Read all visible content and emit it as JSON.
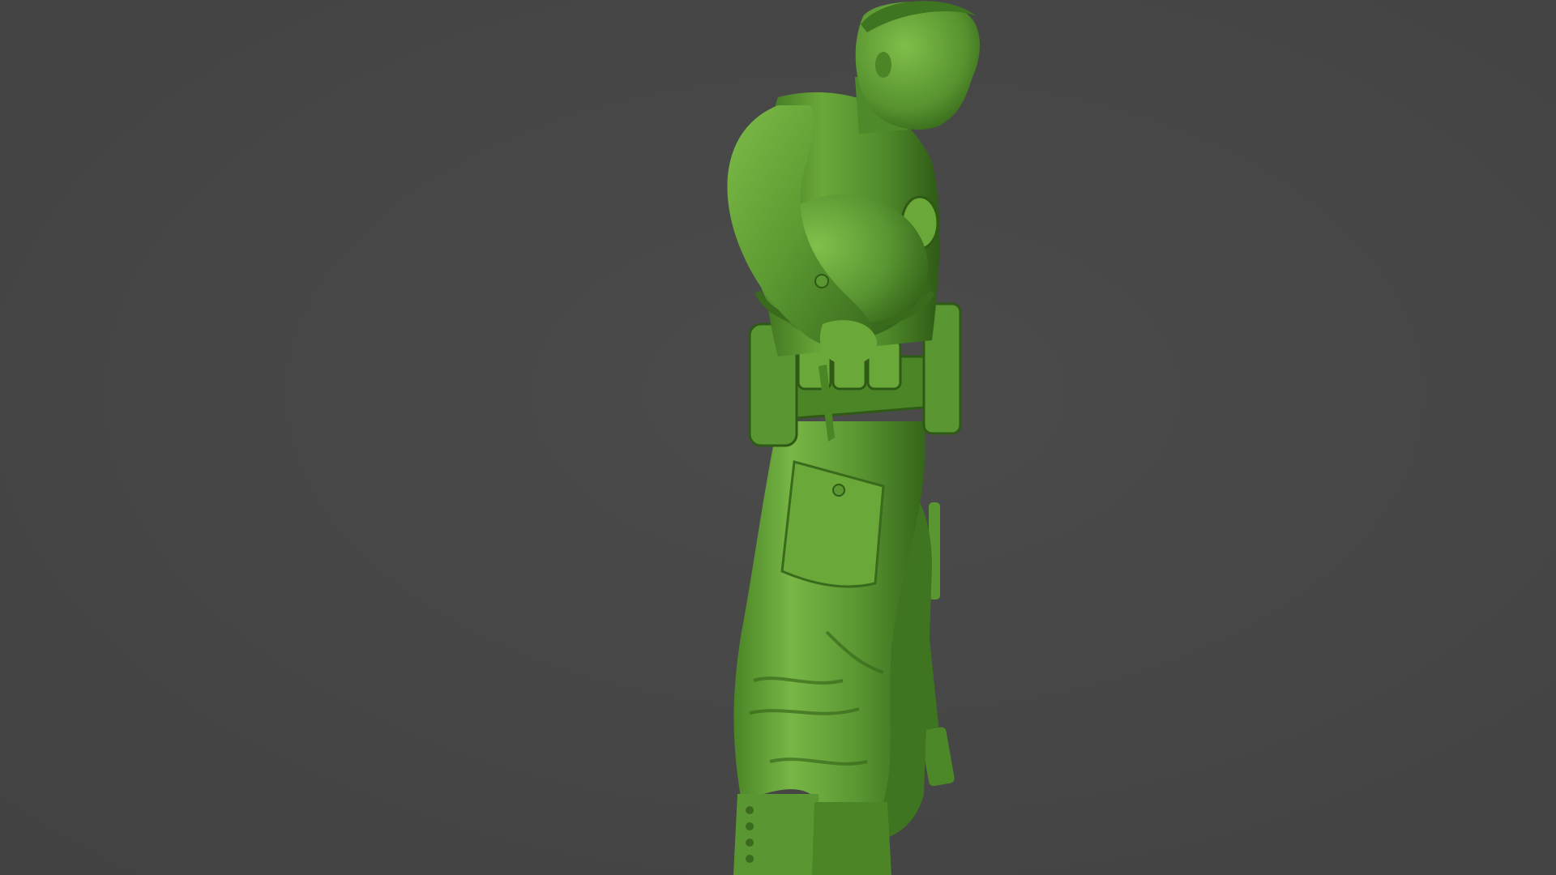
{
  "scene": {
    "background_color": "#464646",
    "model_color": "#4f8a2a",
    "model_highlight": "#7fbf4a",
    "model_shadow": "#2f5a16",
    "subject": "green-army-soldier-figure"
  }
}
